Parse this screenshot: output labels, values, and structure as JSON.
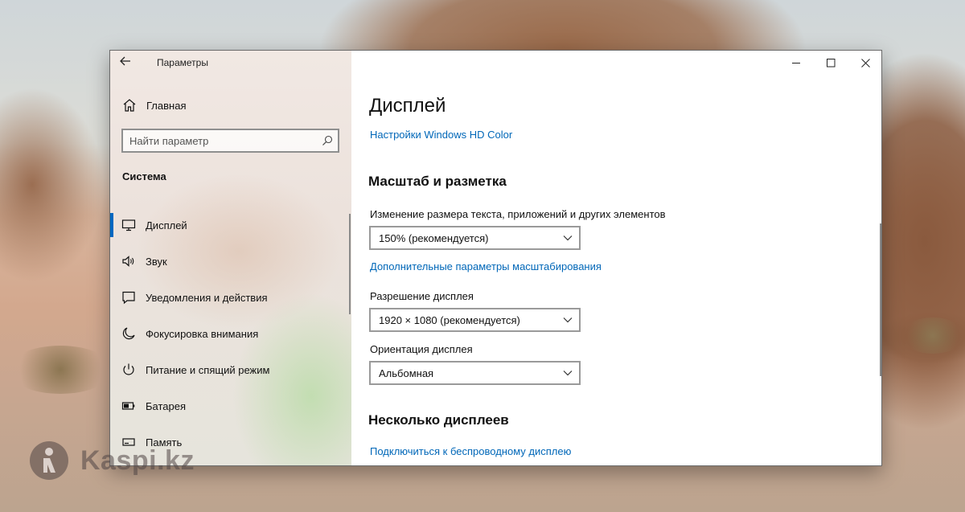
{
  "window": {
    "title": "Параметры"
  },
  "sidebar": {
    "home_label": "Главная",
    "search_placeholder": "Найти параметр",
    "section_title": "Система",
    "items": [
      {
        "label": "Дисплей",
        "icon": "monitor-icon",
        "selected": true
      },
      {
        "label": "Звук",
        "icon": "speaker-icon",
        "selected": false
      },
      {
        "label": "Уведомления и действия",
        "icon": "notification-icon",
        "selected": false
      },
      {
        "label": "Фокусировка внимания",
        "icon": "moon-icon",
        "selected": false
      },
      {
        "label": "Питание и спящий режим",
        "icon": "power-icon",
        "selected": false
      },
      {
        "label": "Батарея",
        "icon": "battery-icon",
        "selected": false
      },
      {
        "label": "Память",
        "icon": "storage-icon",
        "selected": false
      }
    ]
  },
  "main": {
    "page_title": "Дисплей",
    "hd_color_link": "Настройки Windows HD Color",
    "scale_section": {
      "title": "Масштаб и разметка",
      "size_label": "Изменение размера текста, приложений и других элементов",
      "size_value": "150% (рекомендуется)",
      "advanced_link": "Дополнительные параметры масштабирования",
      "resolution_label": "Разрешение дисплея",
      "resolution_value": "1920 × 1080 (рекомендуется)",
      "orientation_label": "Ориентация дисплея",
      "orientation_value": "Альбомная"
    },
    "multi_section": {
      "title": "Несколько дисплеев",
      "wireless_link": "Подключиться к беспроводному дисплею"
    }
  },
  "watermark": {
    "text": "Kaspi.kz"
  },
  "colors": {
    "accent": "#0067c0",
    "link": "#0067b8"
  }
}
